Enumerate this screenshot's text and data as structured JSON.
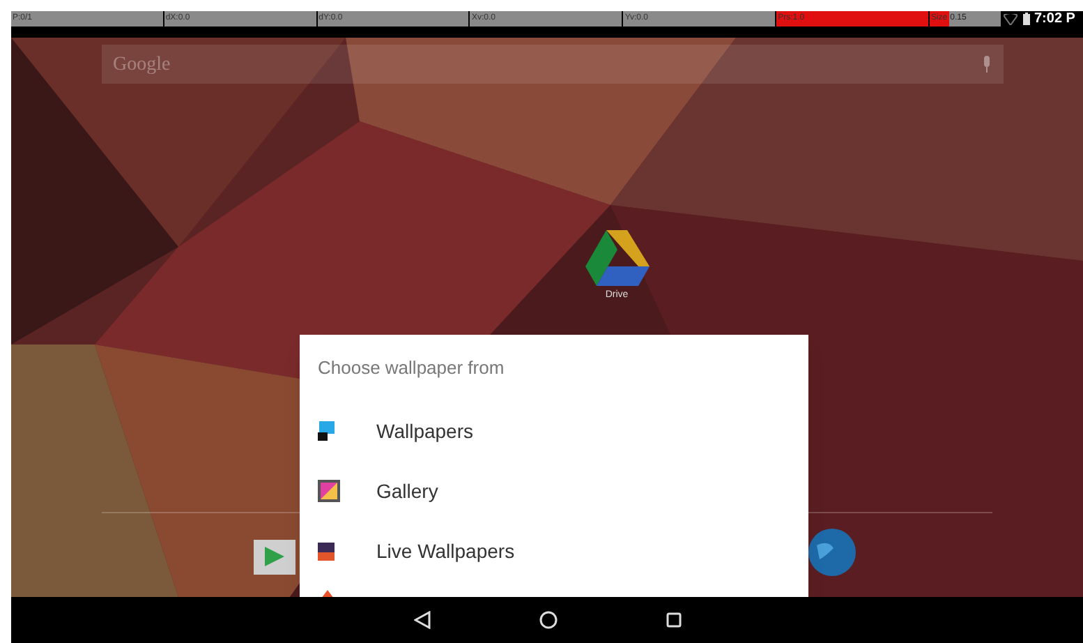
{
  "pointer_bar": {
    "fields": [
      {
        "kind": "plain",
        "text": "P:0/1"
      },
      {
        "kind": "plain",
        "text": "dX:0.0"
      },
      {
        "kind": "plain",
        "text": "dY:0.0"
      },
      {
        "kind": "plain",
        "text": "Xv:0.0"
      },
      {
        "kind": "plain",
        "text": "Yv:0.0"
      },
      {
        "kind": "alert",
        "text": "Prs:1.0"
      },
      {
        "kind": "split",
        "label": "Size",
        "text": "0.15"
      }
    ]
  },
  "status_bar": {
    "time": "7:02 P"
  },
  "search": {
    "placeholder": "Google"
  },
  "desktop_icons": [
    {
      "label": "Drive"
    }
  ],
  "dialog": {
    "title": "Choose wallpaper from",
    "items": [
      {
        "label": "Wallpapers",
        "kind": "wallpapers"
      },
      {
        "label": "Gallery",
        "kind": "gallery"
      },
      {
        "label": "Live Wallpapers",
        "kind": "live"
      }
    ]
  }
}
